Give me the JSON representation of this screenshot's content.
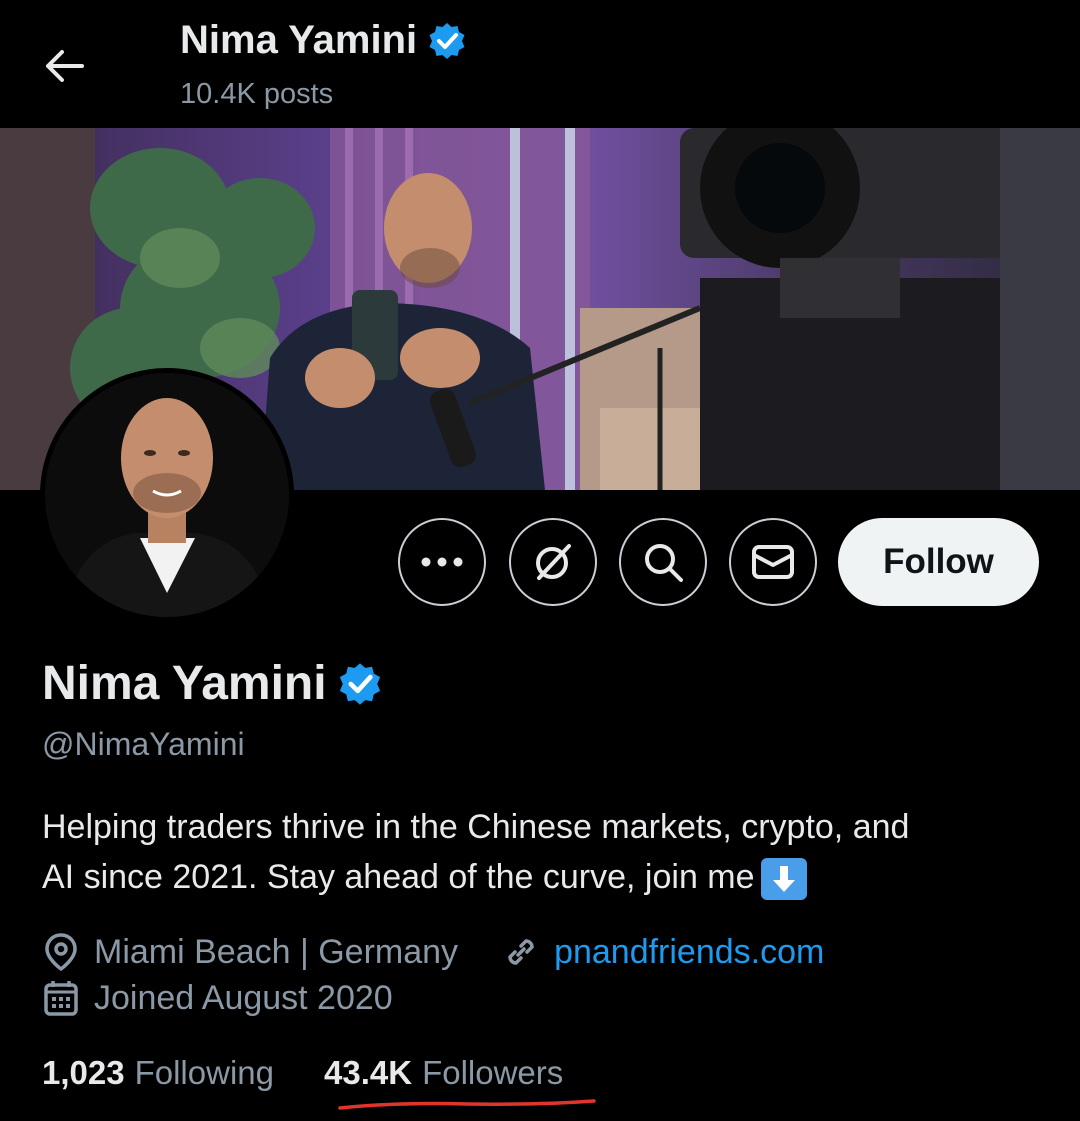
{
  "header": {
    "title": "Nima Yamini",
    "posts": "10.4K posts"
  },
  "actions": {
    "more_icon": "more-icon",
    "grok_icon": "grok-icon",
    "search_icon": "search-icon",
    "message_icon": "message-icon",
    "follow_label": "Follow"
  },
  "profile": {
    "name": "Nima Yamini",
    "handle": "@NimaYamini",
    "bio_line1": "Helping traders thrive in the Chinese markets, crypto, and",
    "bio_line2": "AI since 2021. Stay ahead of the curve, join me",
    "location": "Miami Beach | Germany",
    "website": "pnandfriends.com",
    "joined": "Joined August 2020"
  },
  "stats": {
    "following_count": "1,023",
    "following_label": "Following",
    "followers_count": "43.4K",
    "followers_label": "Followers"
  },
  "colors": {
    "background": "#000000",
    "accent": "#1d9bf0",
    "muted": "#8b98a5",
    "underline": "#e0342c"
  }
}
